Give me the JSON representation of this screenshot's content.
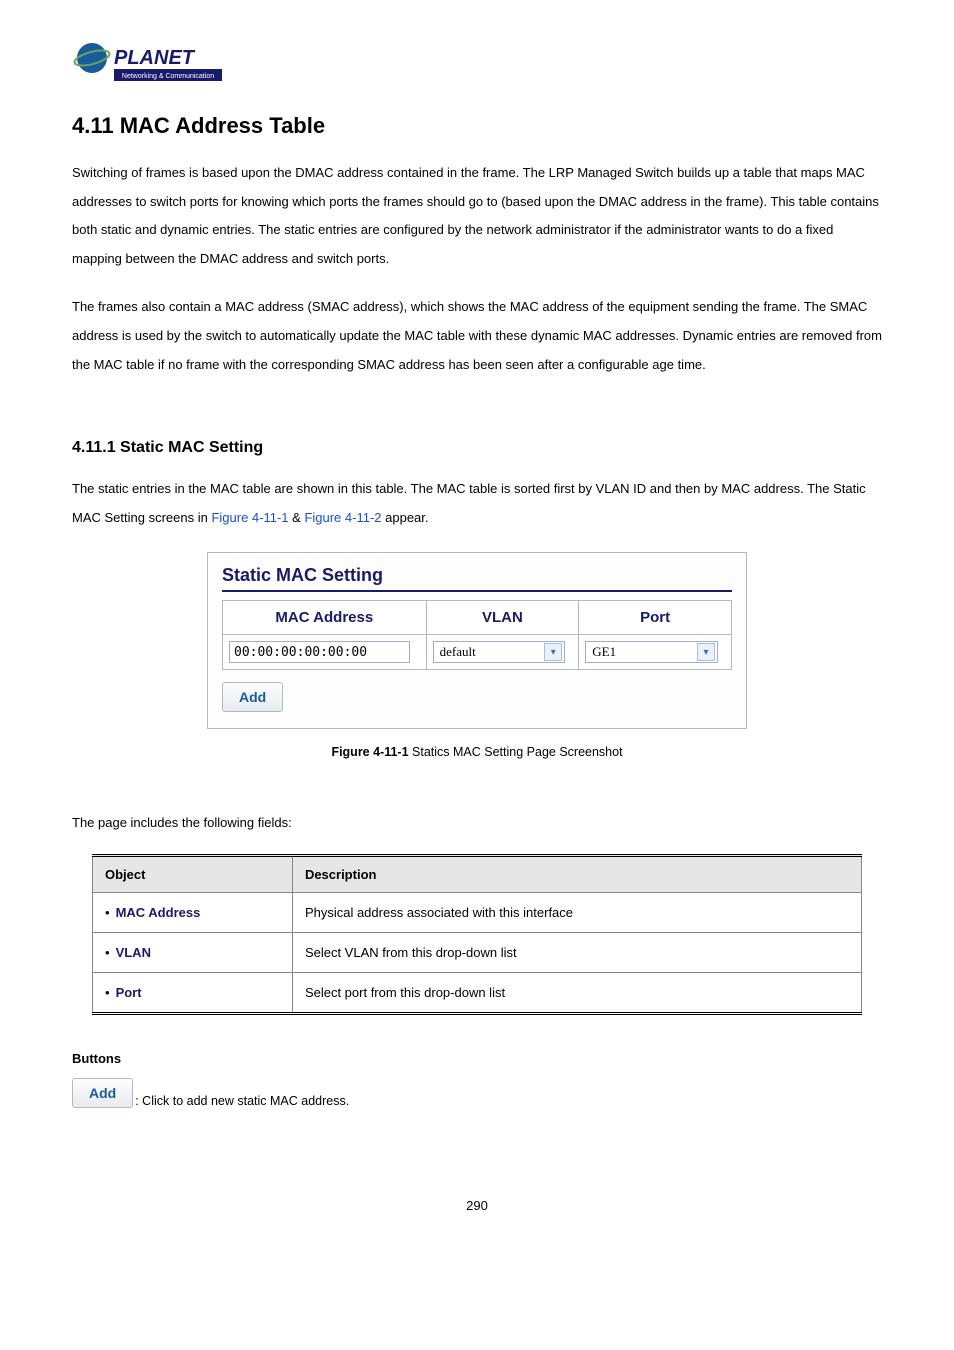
{
  "logo": {
    "brand": "PLANET",
    "tagline": "Networking & Communication"
  },
  "section_heading": "4.11 MAC Address Table",
  "para1": "Switching of frames is based upon the DMAC address contained in the frame. The LRP Managed Switch builds up a table that maps MAC addresses to switch ports for knowing which ports the frames should go to (based upon the DMAC address in the frame). This table contains both static and dynamic entries. The static entries are configured by the network administrator if the administrator wants to do a fixed mapping between the DMAC address and switch ports.",
  "para2": "The frames also contain a MAC address (SMAC address), which shows the MAC address of the equipment sending the frame. The SMAC address is used by the switch to automatically update the MAC table with these dynamic MAC addresses. Dynamic entries are removed from the MAC table if no frame with the corresponding SMAC address has been seen after a configurable age time.",
  "subsection_heading": "4.11.1 Static MAC Setting",
  "sub_intro_pre": "The static entries in the MAC table are shown in this table. The MAC table is sorted first by VLAN ID and then by MAC address. The Static MAC Setting screens in ",
  "fig_link1": "Figure 4-11-1",
  "sub_intro_mid": " & ",
  "fig_link2": "Figure 4-11-2",
  "sub_intro_post": " appear.",
  "screenshot": {
    "title": "Static MAC Setting",
    "headers": {
      "mac": "MAC Address",
      "vlan": "VLAN",
      "port": "Port"
    },
    "values": {
      "mac": "00:00:00:00:00:00",
      "vlan": "default",
      "port": "GE1"
    },
    "add_label": "Add"
  },
  "figure_caption_bold": "Figure 4-11-1",
  "figure_caption_rest": " Statics MAC Setting Page Screenshot",
  "fields_intro": "The page includes the following fields:",
  "fields_table": {
    "head_object": "Object",
    "head_desc": "Description",
    "rows": [
      {
        "obj": "MAC Address",
        "desc": "Physical address associated with this interface"
      },
      {
        "obj": "VLAN",
        "desc": "Select VLAN from this drop-down list"
      },
      {
        "obj": "Port",
        "desc": "Select port from this drop-down list"
      }
    ]
  },
  "buttons_label": "Buttons",
  "add_button": {
    "label": "Add",
    "desc": ": Click to add new static MAC address."
  },
  "page_number": "290"
}
